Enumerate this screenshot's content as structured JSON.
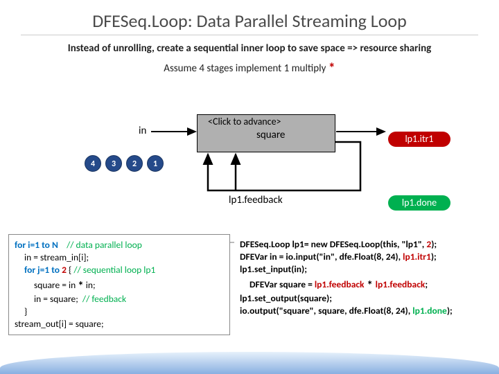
{
  "title": "DFESeq.Loop: Data Parallel Streaming Loop",
  "subtitle": "Instead of unrolling, create a sequential inner loop to save space => resource sharing",
  "assume_prefix": "Assume 4 stages implement 1 multiply ",
  "assume_star": "*",
  "in_label": "in",
  "click_advance": "<Click to advance>",
  "square_label": "square",
  "itr1": "lp1.itr1",
  "done": "lp1.done",
  "feedback": "lp1.feedback",
  "dots": {
    "d4": "4",
    "d3": "3",
    "d2": "2",
    "d1": "1"
  },
  "leftcode": {
    "l1a": "for i=1 to N",
    "l1b": "// data parallel loop",
    "l2": "in = stream_in[i];",
    "l3a": "for j=1 to ",
    "l3b": "2",
    "l3c": " { ",
    "l3d": "// sequential loop lp1",
    "l4a": "square = in ",
    "l4b": "*",
    "l4c": " in;",
    "l5a": "in = square;",
    "l5b": "// feedback",
    "l6": "}",
    "l7": "stream_out[i] = square;"
  },
  "rightcode": {
    "r1a": "DFESeq.Loop lp1= new DFESeq.Loop(this, \"lp1\", ",
    "r1b": "2",
    "r1c": ");",
    "r2a": "DFEVar in = io.input(\"in\", dfe.Float(8, 24), ",
    "r2b": "lp1.itr1",
    "r2c": ");",
    "r3": "lp1.set_input(in);",
    "r4a": "DFEVar square = ",
    "r4b": "lp1.feedback",
    "r4c": " * ",
    "r4d": "lp1.feedback",
    "r4e": ";",
    "r5": "lp1.set_output(square);",
    "r6a": "io.output(\"square\", square, dfe.Float(8, 24), ",
    "r6b": "lp1.done",
    "r6c": ");"
  }
}
